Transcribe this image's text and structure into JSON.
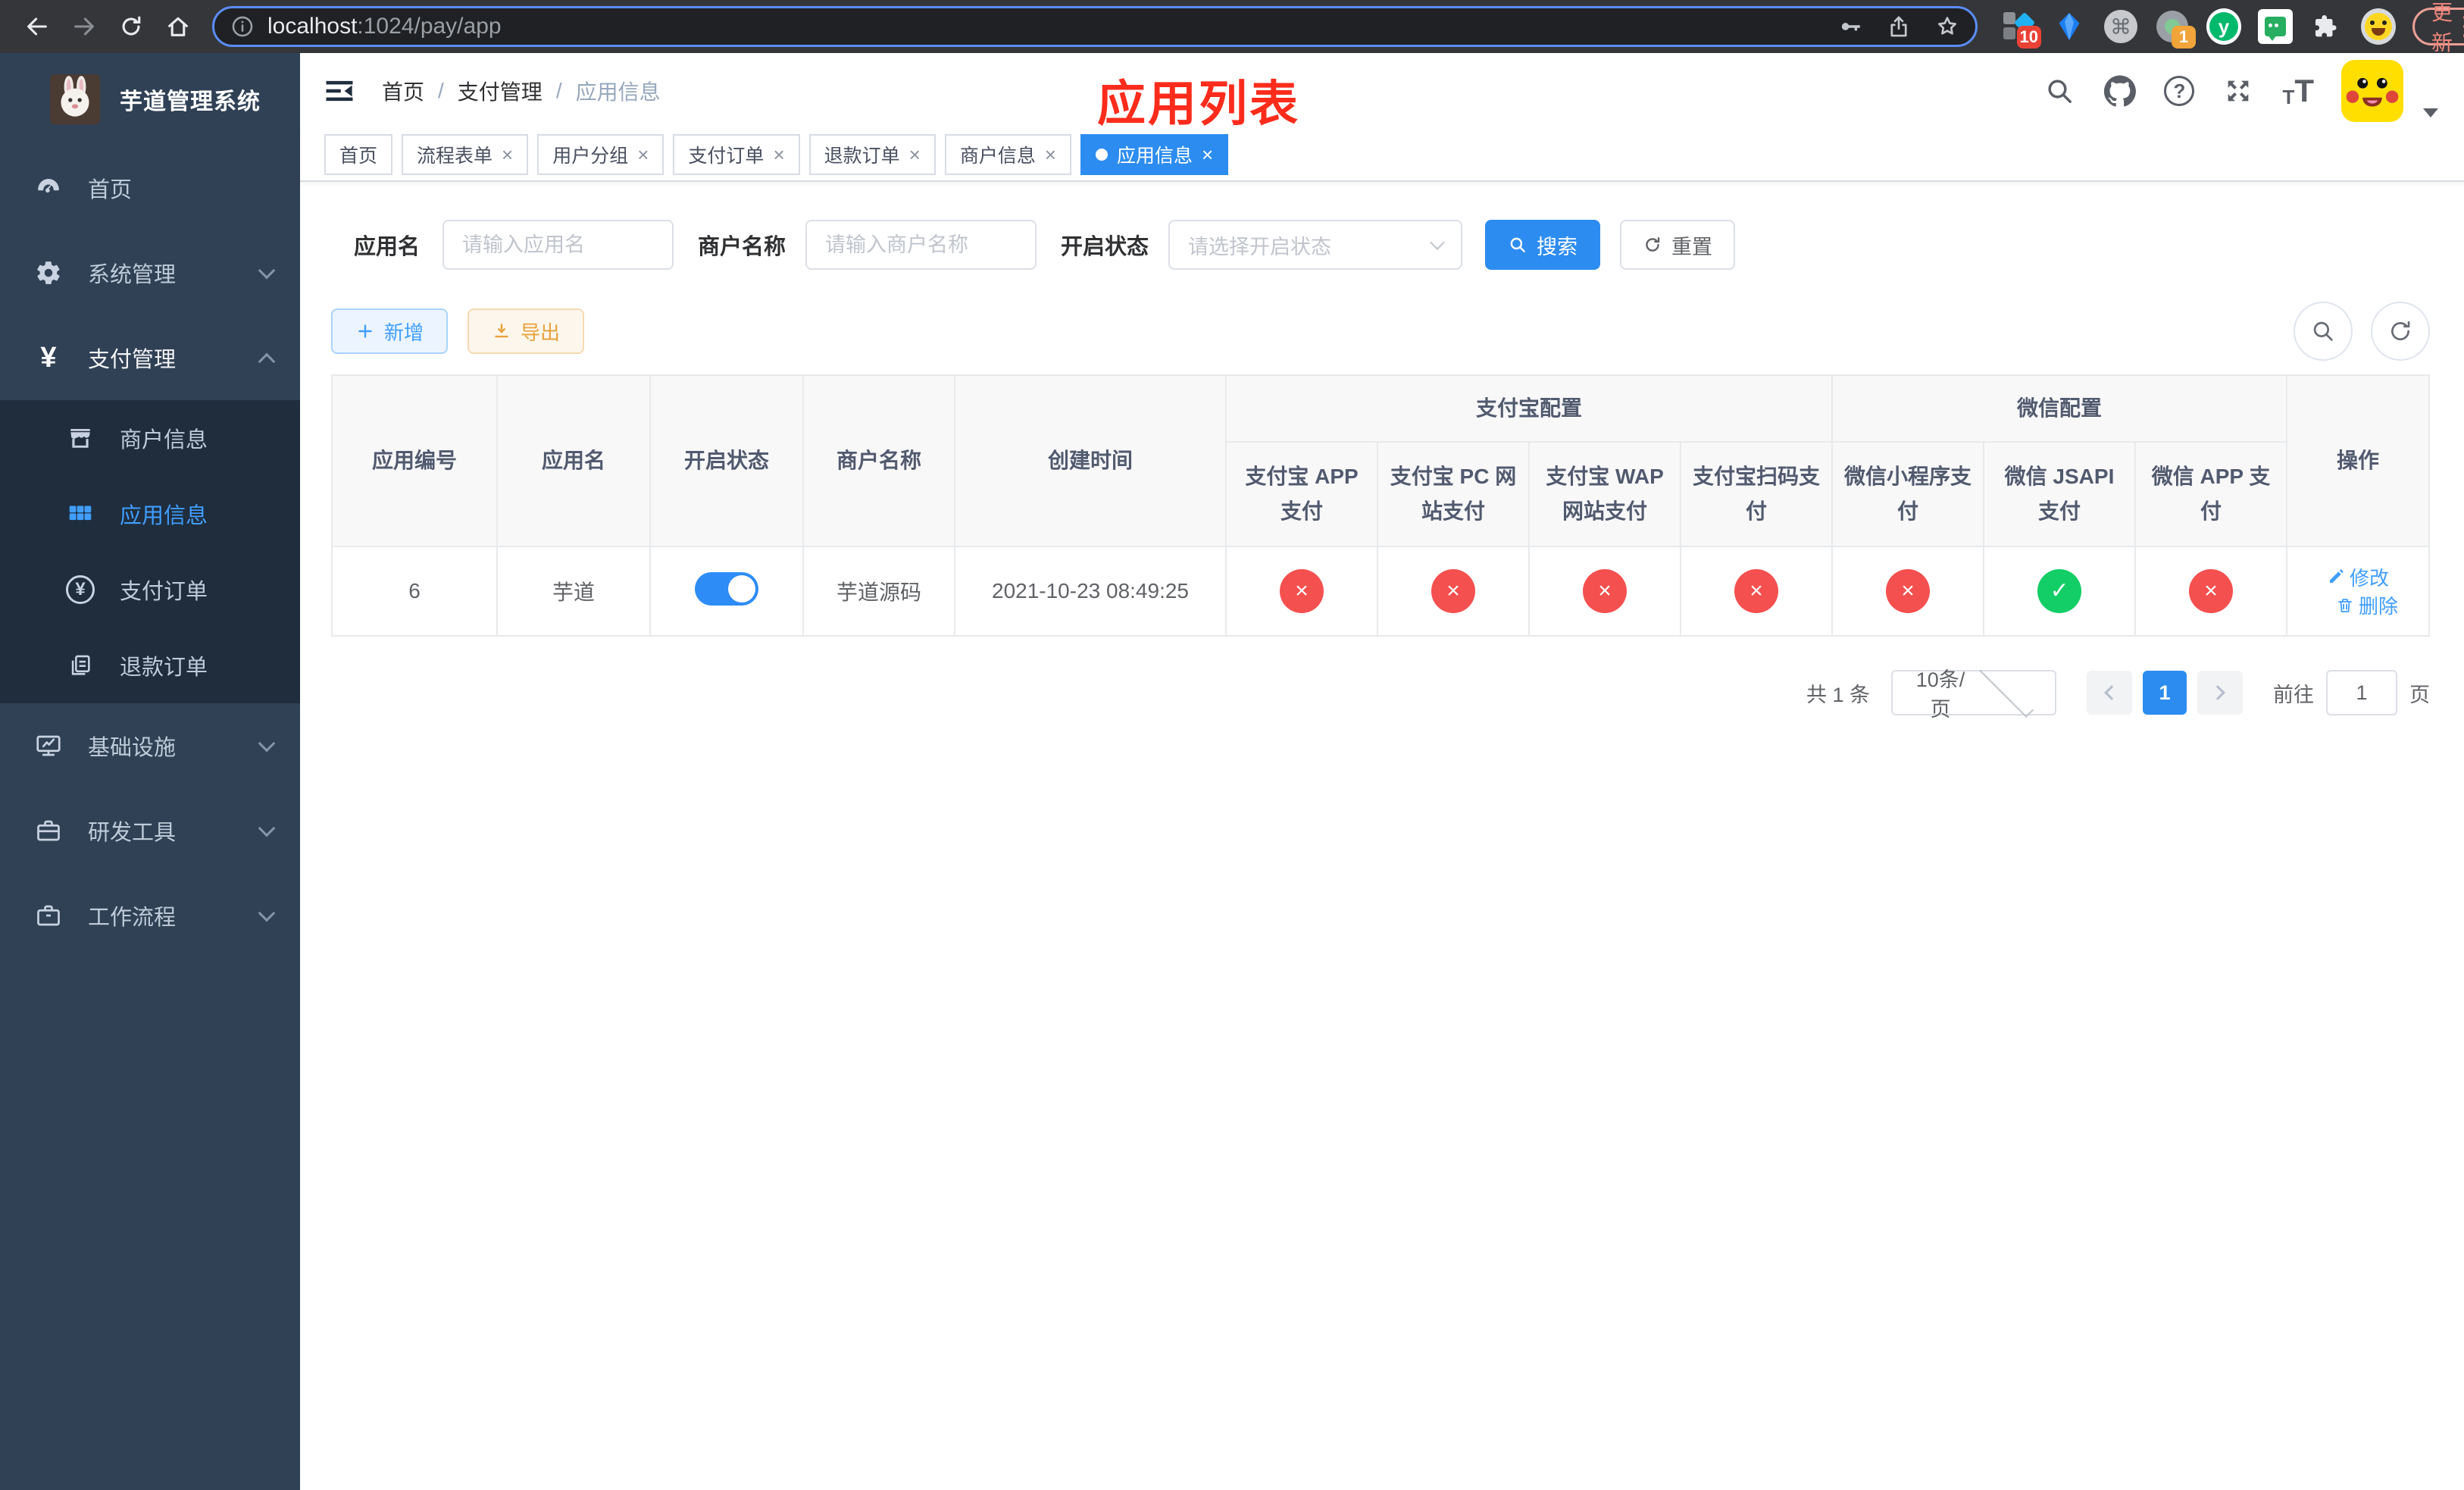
{
  "browser": {
    "url_host": "localhost",
    "url_path": ":1024/pay/app",
    "update_label": "更新",
    "badge_grid": "10",
    "badge_record": "1",
    "yuque_letter": "y"
  },
  "sidebar": {
    "title": "芋道管理系统",
    "home": "首页",
    "system": "系统管理",
    "pay": "支付管理",
    "merchant": "商户信息",
    "app_info": "应用信息",
    "pay_order": "支付订单",
    "refund_order": "退款订单",
    "infra": "基础设施",
    "dev_tools": "研发工具",
    "workflow": "工作流程",
    "yen": "¥"
  },
  "breadcrumb": {
    "home": "首页",
    "sep": "/",
    "pay": "支付管理",
    "current": "应用信息"
  },
  "annotation": "应用列表",
  "tabs": {
    "home": "首页",
    "items": [
      {
        "label": "流程表单"
      },
      {
        "label": "用户分组"
      },
      {
        "label": "支付订单"
      },
      {
        "label": "退款订单"
      },
      {
        "label": "商户信息"
      }
    ],
    "active": "应用信息",
    "close": "×"
  },
  "search": {
    "app_name_label": "应用名",
    "app_name_placeholder": "请输入应用名",
    "merchant_label": "商户名称",
    "merchant_placeholder": "请输入商户名称",
    "status_label": "开启状态",
    "status_placeholder": "请选择开启状态",
    "search_btn": "搜索",
    "reset_btn": "重置"
  },
  "toolbar": {
    "add": "新增",
    "export": "导出"
  },
  "table": {
    "headers": {
      "app_id": "应用编号",
      "app_name": "应用名",
      "status": "开启状态",
      "merchant": "商户名称",
      "create_time": "创建时间",
      "alipay_group": "支付宝配置",
      "wechat_group": "微信配置",
      "actions": "操作",
      "alipay_app": "支付宝 APP 支付",
      "alipay_pc": "支付宝 PC 网站支付",
      "alipay_wap": "支付宝 WAP 网站支付",
      "alipay_scan": "支付宝扫码支付",
      "wx_mini": "微信小程序支付",
      "wx_jsapi": "微信 JSAPI 支付",
      "wx_app": "微信 APP 支付"
    },
    "row": {
      "app_id": "6",
      "app_name": "芋道",
      "enabled": true,
      "merchant": "芋道源码",
      "create_time": "2021-10-23 08:49:25",
      "pay_configs": [
        false,
        false,
        false,
        false,
        false,
        true,
        false
      ]
    },
    "glyphs": {
      "ok": "✓",
      "fail": "×"
    },
    "actions": {
      "edit": "修改",
      "delete": "删除"
    }
  },
  "pagination": {
    "total": "共 1 条",
    "page_size": "10条/页",
    "page": "1",
    "goto_label": "前往",
    "jump_value": "1",
    "page_unit": "页"
  }
}
